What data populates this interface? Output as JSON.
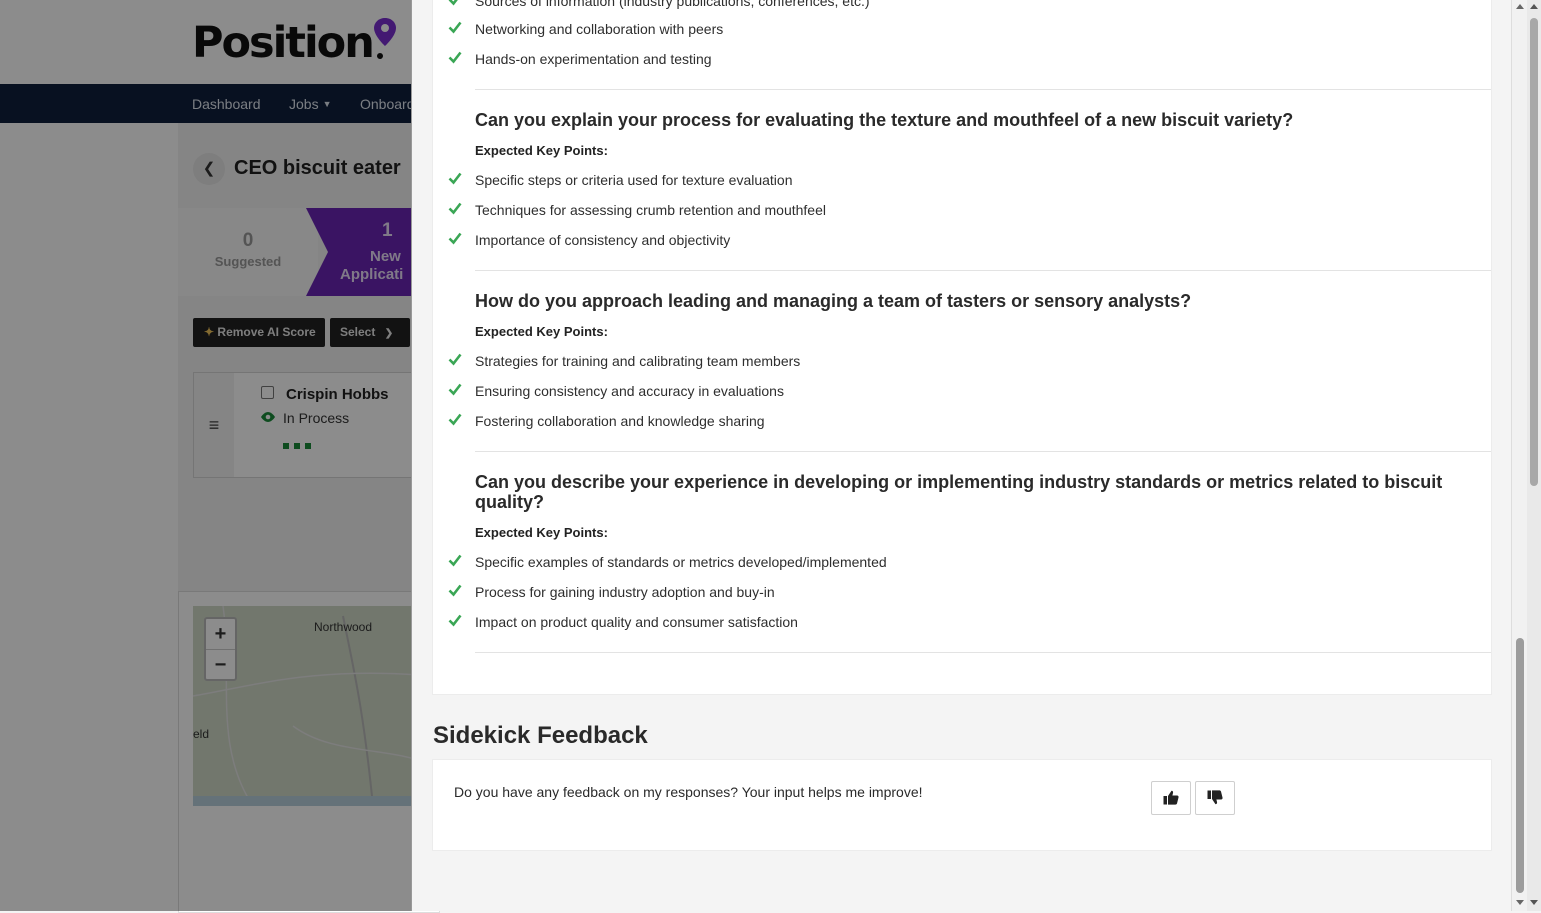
{
  "app": {
    "logo_text": "Position",
    "nav": {
      "dashboard": "Dashboard",
      "jobs": "Jobs",
      "onboarding": "Onboard"
    },
    "job_title": "CEO biscuit eater",
    "stages": {
      "suggested_count": "0",
      "suggested_label": "Suggested",
      "new_count": "1",
      "new_label_1": "New",
      "new_label_2": "Applicati"
    },
    "toolbar": {
      "remove_ai_score": "Remove AI Score",
      "select": "Select"
    },
    "candidate": {
      "name": "Crispin Hobbs",
      "status": "In Process"
    },
    "map": {
      "zoom_in": "+",
      "zoom_out": "−",
      "place_1": "Northwood",
      "place_2": "eld"
    }
  },
  "panel": {
    "top_items": [
      "Sources of information (industry publications, conferences, etc.)",
      "Networking and collaboration with peers",
      "Hands-on experimentation and testing"
    ],
    "key_points_label": "Expected Key Points:",
    "questions": [
      {
        "title": "Can you explain your process for evaluating the texture and mouthfeel of a new biscuit variety?",
        "points": [
          "Specific steps or criteria used for texture evaluation",
          "Techniques for assessing crumb retention and mouthfeel",
          "Importance of consistency and objectivity"
        ]
      },
      {
        "title": "How do you approach leading and managing a team of tasters or sensory analysts?",
        "points": [
          "Strategies for training and calibrating team members",
          "Ensuring consistency and accuracy in evaluations",
          "Fostering collaboration and knowledge sharing"
        ]
      },
      {
        "title": "Can you describe your experience in developing or implementing industry standards or metrics related to biscuit quality?",
        "points": [
          "Specific examples of standards or metrics developed/implemented",
          "Process for gaining industry adoption and buy-in",
          "Impact on product quality and consumer satisfaction"
        ]
      }
    ],
    "feedback": {
      "title": "Sidekick Feedback",
      "prompt": "Do you have any feedback on my responses? Your input helps me improve!"
    }
  },
  "colors": {
    "check_green": "#3aa655",
    "nav_bg": "#0f1f3d",
    "brand_purple": "#6a25b5"
  },
  "icons": {
    "check": "check-icon",
    "thumbs_up": "thumbs-up-icon",
    "thumbs_down": "thumbs-down-icon",
    "back": "chevron-left-icon",
    "eye": "eye-icon",
    "handle": "hamburger-icon"
  }
}
